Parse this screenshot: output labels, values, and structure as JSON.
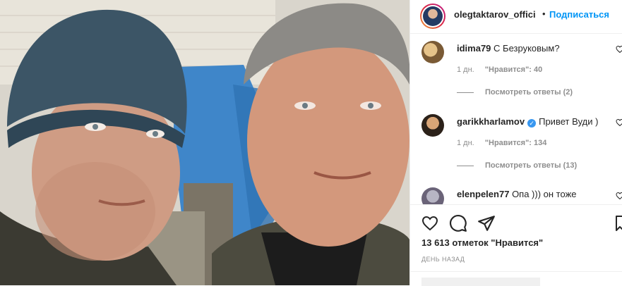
{
  "post": {
    "username": "olegtaktarov_offici",
    "dot": "•",
    "follow_label": "Подписаться"
  },
  "comments": [
    {
      "username": "idima79",
      "text": "С Безруковым?",
      "age": "1 дн.",
      "likes": "\"Нравится\": 40",
      "replies": "Посмотреть ответы (2)",
      "verified": false
    },
    {
      "username": "garikkharlamov",
      "text": "Привет Вуди )",
      "age": "1 дн.",
      "likes": "\"Нравится\": 134",
      "replies": "Посмотреть ответы (13)",
      "verified": true,
      "verified_mark": "✓"
    },
    {
      "username": "elenpelen77",
      "text": "Опа ))) он тоже",
      "verified": false
    }
  ],
  "stats": {
    "likes": "13 613 отметок \"Нравится\"",
    "date": "ДЕНЬ НАЗАД"
  },
  "icons": {
    "heart": "heart-icon",
    "comment": "comment-icon",
    "share": "share-icon",
    "save": "bookmark-icon"
  },
  "colors": {
    "accent": "#0095f6",
    "text": "#262626",
    "muted": "#8e8e8e",
    "verified": "#3897f0"
  }
}
